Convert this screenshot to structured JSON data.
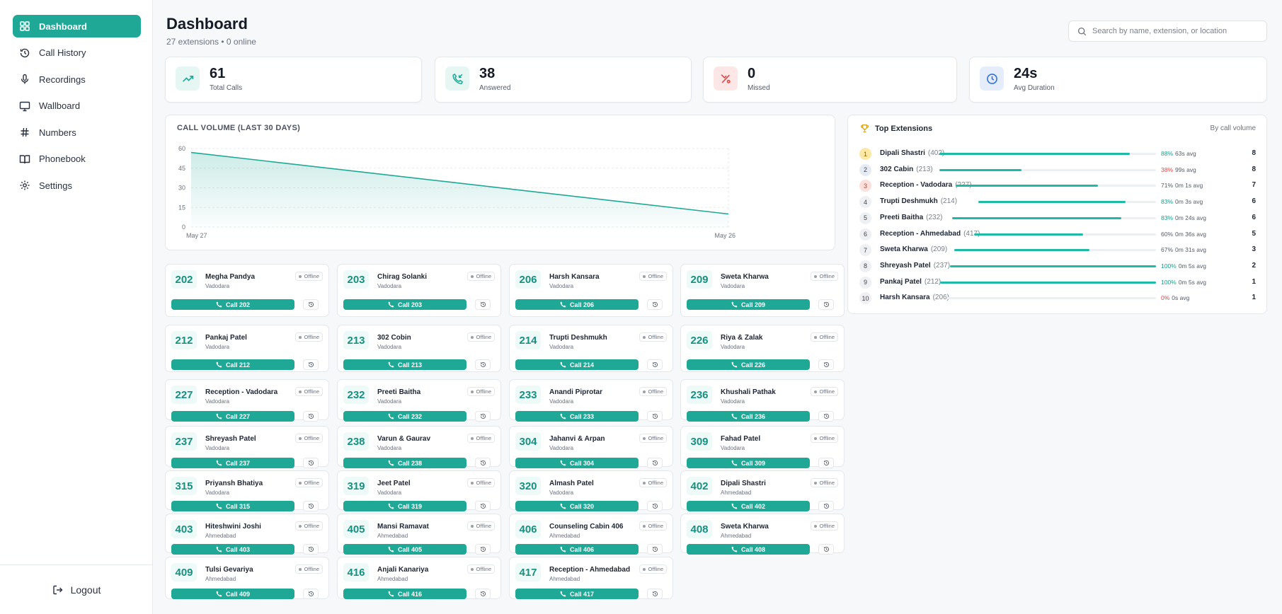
{
  "sidebar": {
    "items": [
      {
        "label": "Dashboard",
        "icon": "grid-icon"
      },
      {
        "label": "Call History",
        "icon": "history-icon"
      },
      {
        "label": "Recordings",
        "icon": "microphone-icon"
      },
      {
        "label": "Wallboard",
        "icon": "monitor-icon"
      },
      {
        "label": "Numbers",
        "icon": "hash-icon"
      },
      {
        "label": "Phonebook",
        "icon": "book-icon"
      },
      {
        "label": "Settings",
        "icon": "gear-icon"
      }
    ],
    "active": "Dashboard",
    "logout_label": "Logout"
  },
  "header": {
    "title": "Dashboard",
    "subtitle": "27 extensions • 0 online",
    "search_placeholder": "Search by name, extension, or location"
  },
  "stats": [
    {
      "value": "61",
      "label": "Total Calls",
      "icon": "trending-up-icon",
      "color": "#1fa896"
    },
    {
      "value": "38",
      "label": "Answered",
      "icon": "phone-incoming-icon",
      "color": "#1fa896"
    },
    {
      "value": "0",
      "label": "Missed",
      "icon": "phone-missed-icon",
      "color": "#e04848"
    },
    {
      "value": "24s",
      "label": "Avg Duration",
      "icon": "clock-icon",
      "color": "#2f6fde"
    }
  ],
  "chart_data": {
    "type": "area",
    "title": "CALL VOLUME (LAST 30 DAYS)",
    "x": [
      "May 27",
      "May 26"
    ],
    "xticks": [
      "May 27",
      "May 26"
    ],
    "yticks": [
      "60",
      "45",
      "30",
      "15",
      "0"
    ],
    "values": [
      57,
      10
    ],
    "ylim": [
      0,
      60
    ],
    "color": "#1fa896",
    "grid": true
  },
  "top_extensions": {
    "title": "Top Extensions",
    "subtitle": "By call volume",
    "rows": [
      {
        "rank": "1",
        "name": "Dipali Shastri",
        "ext": "(402)",
        "answered_pct": 88,
        "pct": "88%",
        "avg": "63s avg",
        "count": "8"
      },
      {
        "rank": "2",
        "name": "302 Cabin",
        "ext": "(213)",
        "answered_pct": 38,
        "pct": "38%",
        "avg": "99s avg",
        "count": "8"
      },
      {
        "rank": "3",
        "name": "Reception - Vadodara",
        "ext": "(227)",
        "answered_pct": 71,
        "pct": "71%",
        "avg": "0m 1s avg",
        "count": "7"
      },
      {
        "rank": "4",
        "name": "Trupti Deshmukh",
        "ext": "(214)",
        "answered_pct": 83,
        "pct": "83%",
        "avg": "0m 3s avg",
        "count": "6"
      },
      {
        "rank": "5",
        "name": "Preeti Baitha",
        "ext": "(232)",
        "answered_pct": 83,
        "pct": "83%",
        "avg": "0m 24s avg",
        "count": "6"
      },
      {
        "rank": "6",
        "name": "Reception - Ahmedabad",
        "ext": "(417)",
        "answered_pct": 60,
        "pct": "60%",
        "avg": "0m 36s avg",
        "count": "5"
      },
      {
        "rank": "7",
        "name": "Sweta Kharwa",
        "ext": "(209)",
        "answered_pct": 67,
        "pct": "67%",
        "avg": "0m 31s avg",
        "count": "3"
      },
      {
        "rank": "8",
        "name": "Shreyash Patel",
        "ext": "(237)",
        "answered_pct": 100,
        "pct": "100%",
        "avg": "0m 5s avg",
        "count": "2"
      },
      {
        "rank": "9",
        "name": "Pankaj Patel",
        "ext": "(212)",
        "answered_pct": 100,
        "pct": "100%",
        "avg": "0m 5s avg",
        "count": "1"
      },
      {
        "rank": "10",
        "name": "Harsh Kansara",
        "ext": "(206)",
        "answered_pct": 0,
        "pct": "0%",
        "avg": "0s avg",
        "count": "1"
      }
    ]
  },
  "extensions": [
    {
      "number": "202",
      "name": "Megha Pandya",
      "location": "Vadodara",
      "status": "Offline",
      "call_label": "Call 202"
    },
    {
      "number": "203",
      "name": "Chirag Solanki",
      "location": "Vadodara",
      "status": "Offline",
      "call_label": "Call 203"
    },
    {
      "number": "206",
      "name": "Harsh Kansara",
      "location": "Vadodara",
      "status": "Offline",
      "call_label": "Call 206"
    },
    {
      "number": "209",
      "name": "Sweta Kharwa",
      "location": "Vadodara",
      "status": "Offline",
      "call_label": "Call 209"
    },
    {
      "number": "212",
      "name": "Pankaj Patel",
      "location": "Vadodara",
      "status": "Offline",
      "call_label": "Call 212"
    },
    {
      "number": "213",
      "name": "302 Cobin",
      "location": "Vadodara",
      "status": "Offline",
      "call_label": "Call 213"
    },
    {
      "number": "214",
      "name": "Trupti Deshmukh",
      "location": "Vadodara",
      "status": "Offline",
      "call_label": "Call 214"
    },
    {
      "number": "226",
      "name": "Riya & Zalak",
      "location": "Vadodara",
      "status": "Offline",
      "call_label": "Call 226"
    },
    {
      "number": "227",
      "name": "Reception - Vadodara",
      "location": "Vadodara",
      "status": "Offline",
      "call_label": "Call 227"
    },
    {
      "number": "232",
      "name": "Preeti Baitha",
      "location": "Vadodara",
      "status": "Offline",
      "call_label": "Call 232"
    },
    {
      "number": "233",
      "name": "Anandi Piprotar",
      "location": "Vadodara",
      "status": "Offline",
      "call_label": "Call 233"
    },
    {
      "number": "236",
      "name": "Khushali Pathak",
      "location": "Vadodara",
      "status": "Offline",
      "call_label": "Call 236"
    },
    {
      "number": "237",
      "name": "Shreyash Patel",
      "location": "Vadodara",
      "status": "Offline",
      "call_label": "Call 237"
    },
    {
      "number": "238",
      "name": "Varun & Gaurav",
      "location": "Vadodara",
      "status": "Offline",
      "call_label": "Call 238"
    },
    {
      "number": "304",
      "name": "Jahanvi & Arpan",
      "location": "Vadodara",
      "status": "Offline",
      "call_label": "Call 304"
    },
    {
      "number": "309",
      "name": "Fahad Patel",
      "location": "Vadodara",
      "status": "Offline",
      "call_label": "Call 309"
    },
    {
      "number": "315",
      "name": "Priyansh Bhatiya",
      "location": "Vadodara",
      "status": "Offline",
      "call_label": "Call 315"
    },
    {
      "number": "319",
      "name": "Jeet Patel",
      "location": "Vadodara",
      "status": "Offline",
      "call_label": "Call 319"
    },
    {
      "number": "320",
      "name": "Almash Patel",
      "location": "Vadodara",
      "status": "Offline",
      "call_label": "Call 320"
    },
    {
      "number": "402",
      "name": "Dipali Shastri",
      "location": "Ahmedabad",
      "status": "Offline",
      "call_label": "Call 402"
    },
    {
      "number": "403",
      "name": "Hiteshwini Joshi",
      "location": "Ahmedabad",
      "status": "Offline",
      "call_label": "Call 403"
    },
    {
      "number": "405",
      "name": "Mansi Ramavat",
      "location": "Ahmedabad",
      "status": "Offline",
      "call_label": "Call 405"
    },
    {
      "number": "406",
      "name": "Counseling Cabin 406",
      "location": "Ahmedabad",
      "status": "Offline",
      "call_label": "Call 406"
    },
    {
      "number": "408",
      "name": "Sweta Kharwa",
      "location": "Ahmedabad",
      "status": "Offline",
      "call_label": "Call 408"
    },
    {
      "number": "409",
      "name": "Tulsi Gevariya",
      "location": "Ahmedabad",
      "status": "Offline",
      "call_label": "Call 409"
    },
    {
      "number": "416",
      "name": "Anjali Kanariya",
      "location": "Ahmedabad",
      "status": "Offline",
      "call_label": "Call 416"
    },
    {
      "number": "417",
      "name": "Reception - Ahmedabad",
      "location": "Ahmedabad",
      "status": "Offline",
      "call_label": "Call 417"
    }
  ]
}
